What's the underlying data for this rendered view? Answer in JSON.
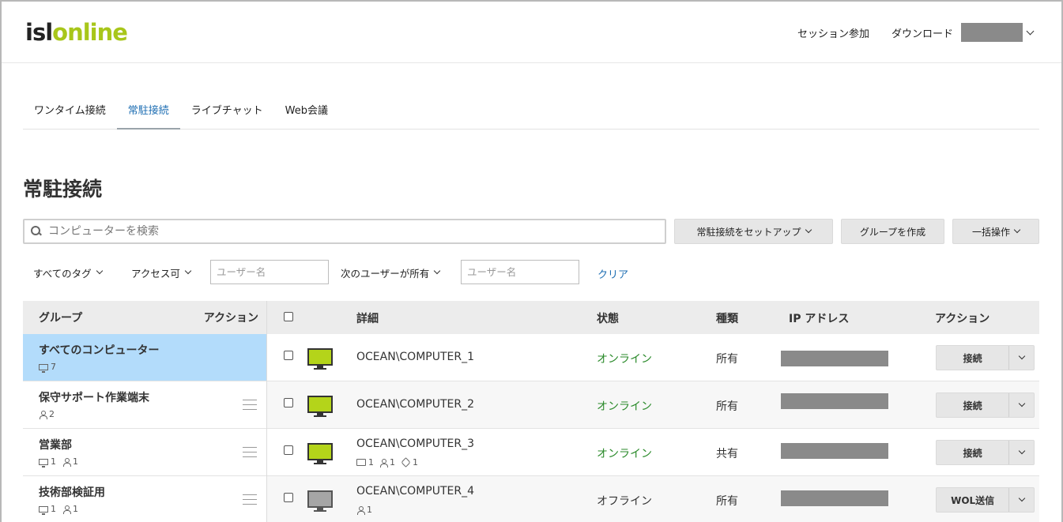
{
  "header": {
    "logo_isl": "isl",
    "logo_online": "online",
    "join_session": "セッション参加",
    "download": "ダウンロード"
  },
  "tabs": [
    {
      "label": "ワンタイム接続",
      "active": false
    },
    {
      "label": "常駐接続",
      "active": true
    },
    {
      "label": "ライブチャット",
      "active": false
    },
    {
      "label": "Web会議",
      "active": false
    }
  ],
  "page_title": "常駐接続",
  "search": {
    "placeholder": "コンピューターを検索",
    "value": ""
  },
  "toolbar": {
    "setup_label": "常駐接続をセットアップ",
    "create_group_label": "グループを作成",
    "bulk_label": "一括操作"
  },
  "filters": {
    "tags_label": "すべてのタグ",
    "access_label": "アクセス可",
    "user_placeholder": "ユーザー名",
    "owner_label": "次のユーザーが所有",
    "owner_placeholder": "ユーザー名",
    "clear_label": "クリア"
  },
  "groups": {
    "header_group": "グループ",
    "header_action": "アクション",
    "items": [
      {
        "name": "すべてのコンピューター",
        "computers": "7",
        "users": "",
        "selected": true
      },
      {
        "name": "保守サポート作業端末",
        "computers": "",
        "users": "2",
        "selected": false
      },
      {
        "name": "営業部",
        "computers": "1",
        "users": "1",
        "selected": false
      },
      {
        "name": "技術部検証用",
        "computers": "1",
        "users": "1",
        "selected": false
      }
    ]
  },
  "table": {
    "headers": {
      "details": "詳細",
      "status": "状態",
      "type": "種類",
      "ip": "IP アドレス",
      "action": "アクション"
    },
    "rows": [
      {
        "name": "OCEAN\\COMPUTER_1",
        "status": "オンライン",
        "online": true,
        "type": "所有",
        "action": "接続",
        "folders": "",
        "users": "",
        "tags": ""
      },
      {
        "name": "OCEAN\\COMPUTER_2",
        "status": "オンライン",
        "online": true,
        "type": "所有",
        "action": "接続",
        "folders": "",
        "users": "",
        "tags": ""
      },
      {
        "name": "OCEAN\\COMPUTER_3",
        "status": "オンライン",
        "online": true,
        "type": "共有",
        "action": "接続",
        "folders": "1",
        "users": "1",
        "tags": "1"
      },
      {
        "name": "OCEAN\\COMPUTER_4",
        "status": "オフライン",
        "online": false,
        "type": "所有",
        "action": "WOL送信",
        "folders": "",
        "users": "1",
        "tags": ""
      }
    ]
  },
  "colors": {
    "brand_green": "#a8c61a",
    "online_green": "#2a8a2a",
    "link_blue": "#1f6fb3",
    "selected_group": "#b3dcfb"
  }
}
